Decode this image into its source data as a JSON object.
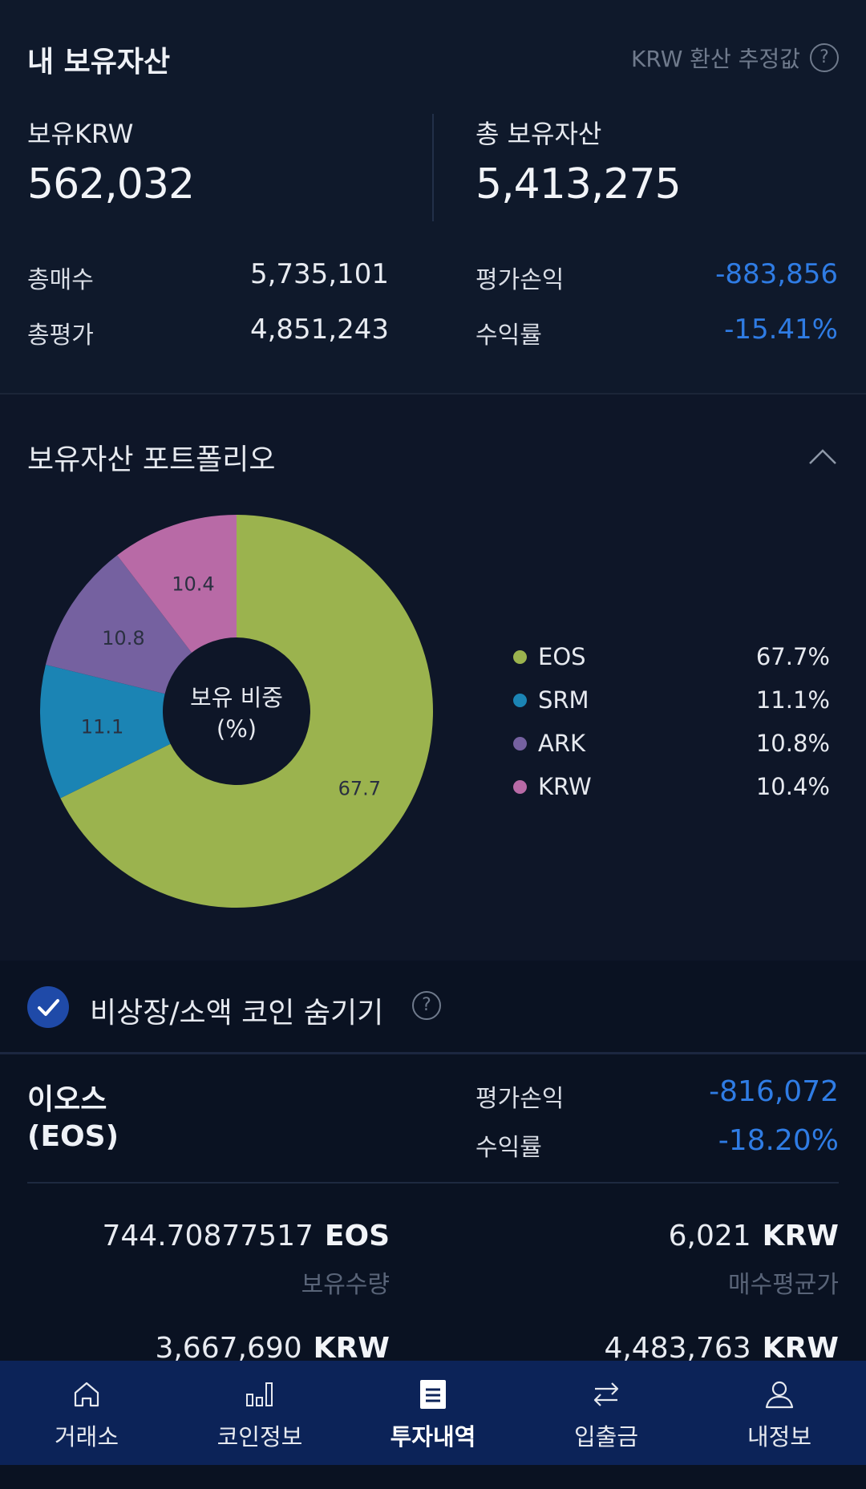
{
  "summary": {
    "title": "내 보유자산",
    "krw_note": "KRW 환산 추정값",
    "help_icon": "question-circle-icon",
    "held_krw_label": "보유KRW",
    "held_krw_value": "562,032",
    "total_assets_label": "총 보유자산",
    "total_assets_value": "5,413,275",
    "total_buy_label": "총매수",
    "total_buy_value": "5,735,101",
    "total_eval_label": "총평가",
    "total_eval_value": "4,851,243",
    "pnl_label": "평가손익",
    "pnl_value": "-883,856",
    "return_label": "수익률",
    "return_value": "-15.41%"
  },
  "portfolio": {
    "title": "보유자산 포트폴리오",
    "center_label_1": "보유 비중",
    "center_label_2": "(%)",
    "legend": [
      {
        "name": "EOS",
        "value": "67.7%",
        "color": "#9bb34e"
      },
      {
        "name": "SRM",
        "value": "11.1%",
        "color": "#1b84b4"
      },
      {
        "name": "ARK",
        "value": "10.8%",
        "color": "#7561a0"
      },
      {
        "name": "KRW",
        "value": "10.4%",
        "color": "#b86aa6"
      }
    ]
  },
  "chart_data": {
    "type": "pie",
    "categories": [
      "EOS",
      "SRM",
      "ARK",
      "KRW"
    ],
    "values": [
      67.7,
      11.1,
      10.8,
      10.4
    ],
    "labels": [
      "67.7",
      "11.1",
      "10.8",
      "10.4"
    ],
    "colors": [
      "#9bb34e",
      "#1b84b4",
      "#7561a0",
      "#b86aa6"
    ],
    "title": "",
    "legend": "right"
  },
  "hide_coins": {
    "label": "비상장/소액 코인 숨기기",
    "checked": true
  },
  "coin": {
    "name_line1": "이오스",
    "name_line2": "(EOS)",
    "pnl_label": "평가손익",
    "pnl_value": "-816,072",
    "return_label": "수익률",
    "return_value": "-18.20%",
    "qty_value": "744.70877517",
    "qty_unit": "EOS",
    "qty_label": "보유수량",
    "avg_value": "6,021",
    "avg_unit": "KRW",
    "avg_label": "매수평균가",
    "row2_left_value": "3,667,690",
    "row2_left_unit": "KRW",
    "row2_right_value": "4,483,763",
    "row2_right_unit": "KRW"
  },
  "nav": {
    "items": [
      {
        "label": "거래소",
        "icon": "home-icon"
      },
      {
        "label": "코인정보",
        "icon": "bar-chart-icon"
      },
      {
        "label": "투자내역",
        "icon": "list-doc-icon",
        "active": true
      },
      {
        "label": "입출금",
        "icon": "transfer-arrows-icon"
      },
      {
        "label": "내정보",
        "icon": "user-icon"
      }
    ]
  }
}
